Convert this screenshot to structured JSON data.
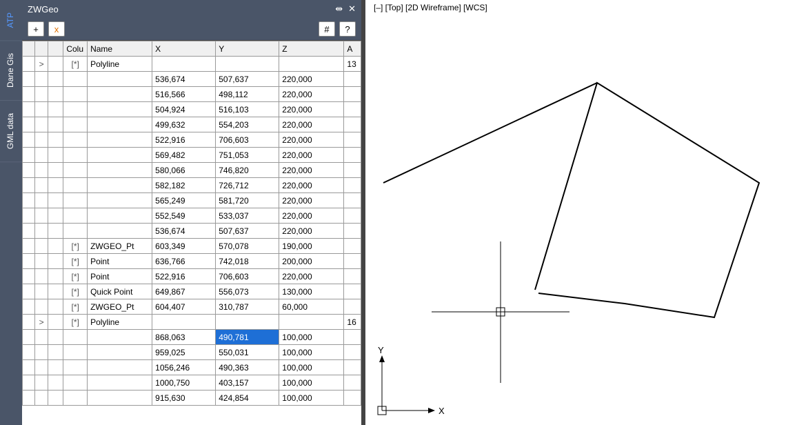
{
  "side_tabs": {
    "atp": "ATP",
    "dane_gis": "Dane Gis",
    "gml_data": "GML data",
    "active": "atp"
  },
  "panel": {
    "title": "ZWGeo",
    "toolbar": {
      "add": "+",
      "close_x": "x",
      "hash": "#",
      "help": "?"
    },
    "icons": {
      "autohide": "⇹",
      "close": "✕"
    }
  },
  "columns": {
    "c0": "",
    "c1": "",
    "c2": "",
    "colu": "Colu",
    "name": "Name",
    "x": "X",
    "y": "Y",
    "z": "Z",
    "ext": "A"
  },
  "rows": [
    {
      "type": "parent",
      "expand": ">",
      "bracket": "[*]",
      "name": "Polyline",
      "x": "",
      "y": "",
      "z": "",
      "ext": "13"
    },
    {
      "type": "data",
      "x": "536,674",
      "y": "507,637",
      "z": "220,000"
    },
    {
      "type": "data",
      "x": "516,566",
      "y": "498,112",
      "z": "220,000"
    },
    {
      "type": "data",
      "x": "504,924",
      "y": "516,103",
      "z": "220,000"
    },
    {
      "type": "data",
      "x": "499,632",
      "y": "554,203",
      "z": "220,000"
    },
    {
      "type": "data",
      "x": "522,916",
      "y": "706,603",
      "z": "220,000"
    },
    {
      "type": "data",
      "x": "569,482",
      "y": "751,053",
      "z": "220,000"
    },
    {
      "type": "data",
      "x": "580,066",
      "y": "746,820",
      "z": "220,000"
    },
    {
      "type": "data",
      "x": "582,182",
      "y": "726,712",
      "z": "220,000"
    },
    {
      "type": "data",
      "x": "565,249",
      "y": "581,720",
      "z": "220,000"
    },
    {
      "type": "data",
      "x": "552,549",
      "y": "533,037",
      "z": "220,000"
    },
    {
      "type": "data",
      "x": "536,674",
      "y": "507,637",
      "z": "220,000"
    },
    {
      "type": "entity",
      "bracket": "[*]",
      "name": "ZWGEO_Pt",
      "x": "603,349",
      "y": "570,078",
      "z": "190,000"
    },
    {
      "type": "entity",
      "bracket": "[*]",
      "name": "Point",
      "x": "636,766",
      "y": "742,018",
      "z": "200,000"
    },
    {
      "type": "entity",
      "bracket": "[*]",
      "name": "Point",
      "x": "522,916",
      "y": "706,603",
      "z": "220,000"
    },
    {
      "type": "entity",
      "bracket": "[*]",
      "name": "Quick Point",
      "x": "649,867",
      "y": "556,073",
      "z": "130,000"
    },
    {
      "type": "entity",
      "bracket": "[*]",
      "name": "ZWGEO_Pt",
      "x": "604,407",
      "y": "310,787",
      "z": "60,000"
    },
    {
      "type": "parent",
      "expand": ">",
      "bracket": "[*]",
      "name": "Polyline",
      "x": "",
      "y": "",
      "z": "",
      "ext": "16"
    },
    {
      "type": "data",
      "x": "868,063",
      "y": "490,781",
      "z": "100,000",
      "selected": "y"
    },
    {
      "type": "data",
      "x": "959,025",
      "y": "550,031",
      "z": "100,000"
    },
    {
      "type": "data",
      "x": "1056,246",
      "y": "490,363",
      "z": "100,000"
    },
    {
      "type": "data",
      "x": "1000,750",
      "y": "403,157",
      "z": "100,000"
    },
    {
      "type": "data",
      "x": "915,630",
      "y": "424,854",
      "z": "100,000"
    }
  ],
  "viewport": {
    "label": "[–] [Top] [2D Wireframe] [WCS]",
    "axis_x": "X",
    "axis_y": "Y"
  }
}
